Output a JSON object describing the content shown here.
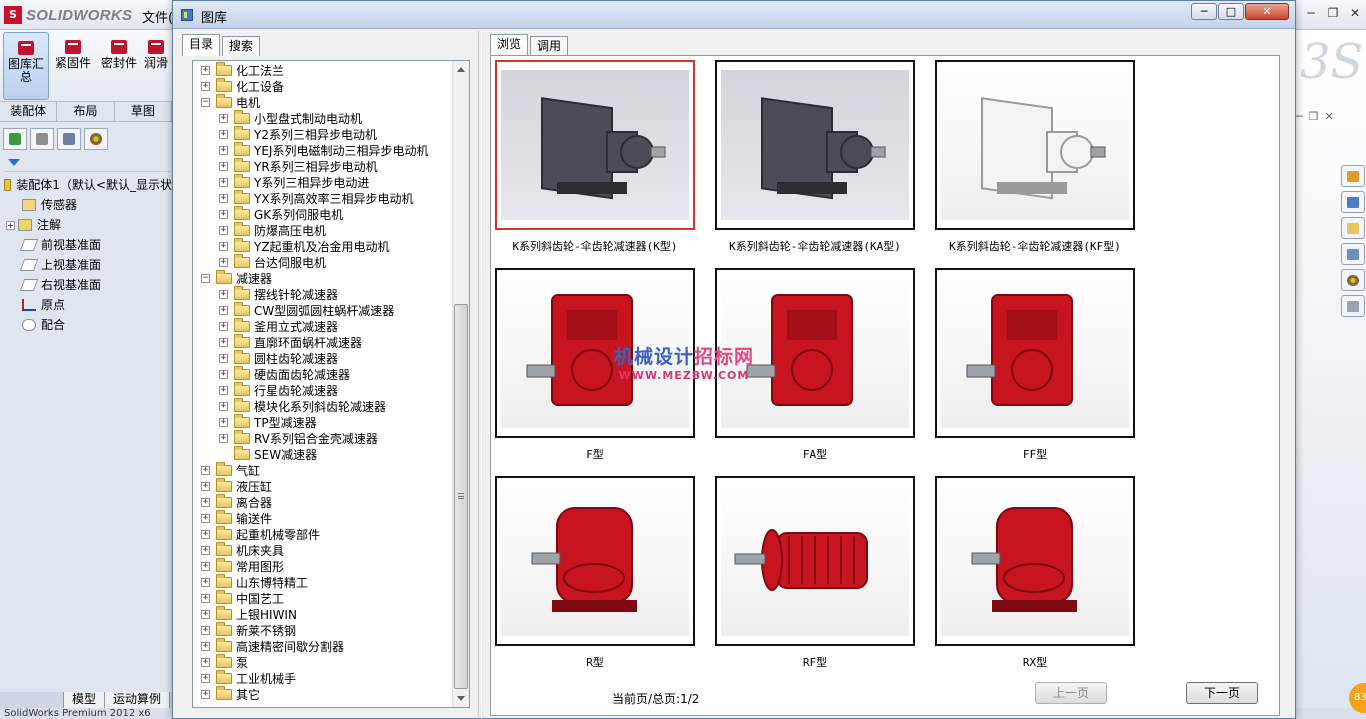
{
  "app": {
    "name": "SOLIDWORKS",
    "menu_first": "文件(",
    "ribbon_buttons": [
      "图库汇总",
      "紧固件",
      "密封件",
      "润滑"
    ],
    "command_tabs": [
      "装配体",
      "布局",
      "草图"
    ],
    "feature_tree": [
      {
        "label": "装配体1（默认<默认_显示状",
        "icon": "assembly-icon"
      },
      {
        "label": "传感器",
        "icon": "sensor-icon"
      },
      {
        "label": "注解",
        "icon": "annotation-icon"
      },
      {
        "label": "前视基准面",
        "icon": "plane-icon"
      },
      {
        "label": "上视基准面",
        "icon": "plane-icon"
      },
      {
        "label": "右视基准面",
        "icon": "plane-icon"
      },
      {
        "label": "原点",
        "icon": "origin-icon"
      },
      {
        "label": "配合",
        "icon": "mate-icon"
      }
    ],
    "bottom_tabs": [
      "模型",
      "运动算例"
    ],
    "status": "SolidWorks Premium 2012 x6",
    "badge": "83"
  },
  "dialog": {
    "title": "图库",
    "left_tabs": [
      "目录",
      "搜索"
    ],
    "tree": [
      {
        "label": "化工法兰",
        "level": 0,
        "expanded": false
      },
      {
        "label": "化工设备",
        "level": 0,
        "expanded": false
      },
      {
        "label": "电机",
        "level": 0,
        "expanded": true
      },
      {
        "label": "小型盘式制动电动机",
        "level": 1,
        "expanded": false
      },
      {
        "label": "Y2系列三相异步电动机",
        "level": 1,
        "expanded": false
      },
      {
        "label": "YEJ系列电磁制动三相异步电动机",
        "level": 1,
        "expanded": false
      },
      {
        "label": "YR系列三相异步电动机",
        "level": 1,
        "expanded": false
      },
      {
        "label": "Y系列三相异步电动进",
        "level": 1,
        "expanded": false
      },
      {
        "label": "YX系列高效率三相异步电动机",
        "level": 1,
        "expanded": false
      },
      {
        "label": "GK系列伺服电机",
        "level": 1,
        "expanded": false
      },
      {
        "label": "防爆高压电机",
        "level": 1,
        "expanded": false
      },
      {
        "label": "YZ起重机及冶金用电动机",
        "level": 1,
        "expanded": false
      },
      {
        "label": "台达伺服电机",
        "level": 1,
        "expanded": false
      },
      {
        "label": "减速器",
        "level": 0,
        "expanded": true
      },
      {
        "label": "摆线针轮减速器",
        "level": 1,
        "expanded": false
      },
      {
        "label": "CW型圆弧圆柱蜗杆减速器",
        "level": 1,
        "expanded": false
      },
      {
        "label": "釜用立式减速器",
        "level": 1,
        "expanded": false
      },
      {
        "label": "直廓环面蜗杆减速器",
        "level": 1,
        "expanded": false
      },
      {
        "label": "圆柱齿轮减速器",
        "level": 1,
        "expanded": false
      },
      {
        "label": "硬齿面齿轮减速器",
        "level": 1,
        "expanded": false
      },
      {
        "label": "行星齿轮减速器",
        "level": 1,
        "expanded": false
      },
      {
        "label": "模块化系列斜齿轮减速器",
        "level": 1,
        "expanded": false
      },
      {
        "label": "TP型减速器",
        "level": 1,
        "expanded": false
      },
      {
        "label": "RV系列铝合金壳减速器",
        "level": 1,
        "expanded": false
      },
      {
        "label": "SEW减速器",
        "level": 1,
        "expanded": null
      },
      {
        "label": "气缸",
        "level": 0,
        "expanded": false
      },
      {
        "label": "液压缸",
        "level": 0,
        "expanded": false
      },
      {
        "label": "离合器",
        "level": 0,
        "expanded": false
      },
      {
        "label": "输送件",
        "level": 0,
        "expanded": false
      },
      {
        "label": "起重机械零部件",
        "level": 0,
        "expanded": false
      },
      {
        "label": "机床夹具",
        "level": 0,
        "expanded": false
      },
      {
        "label": "常用图形",
        "level": 0,
        "expanded": false
      },
      {
        "label": "山东博特精工",
        "level": 0,
        "expanded": false
      },
      {
        "label": "中国艺工",
        "level": 0,
        "expanded": false
      },
      {
        "label": "上银HIWIN",
        "level": 0,
        "expanded": false
      },
      {
        "label": "新莱不锈钢",
        "level": 0,
        "expanded": false
      },
      {
        "label": "高速精密间歇分割器",
        "level": 0,
        "expanded": false
      },
      {
        "label": "泵",
        "level": 0,
        "expanded": false
      },
      {
        "label": "工业机械手",
        "level": 0,
        "expanded": false
      },
      {
        "label": "其它",
        "level": 0,
        "expanded": false
      }
    ],
    "right_tabs": [
      "浏览",
      "调用"
    ],
    "items": [
      {
        "caption": "K系列斜齿轮-伞齿轮减速器(K型)",
        "color": "#4a4d55",
        "bg": "grey",
        "selected": true
      },
      {
        "caption": "K系列斜齿轮-伞齿轮减速器(KA型)",
        "color": "#4a4d55",
        "bg": "grey",
        "selected": false
      },
      {
        "caption": "K系列斜齿轮-伞齿轮减速器(KF型)",
        "color": "#f3f3f3",
        "bg": "white",
        "selected": false
      },
      {
        "caption": "F型",
        "color": "#c8141e",
        "bg": "white",
        "selected": false
      },
      {
        "caption": "FA型",
        "color": "#c8141e",
        "bg": "white",
        "selected": false
      },
      {
        "caption": "FF型",
        "color": "#c8141e",
        "bg": "white",
        "selected": false
      },
      {
        "caption": "R型",
        "color": "#c8141e",
        "bg": "white",
        "selected": false
      },
      {
        "caption": "RF型",
        "color": "#c8141e",
        "bg": "white",
        "selected": false
      },
      {
        "caption": "RX型",
        "color": "#c8141e",
        "bg": "white",
        "selected": false
      }
    ],
    "watermark": {
      "main_prefix": "机械设计",
      "main_suffix": "招标网",
      "url": "WWW.MEZBW.COM"
    },
    "pager": "当前页/总页:1/2",
    "prev_button": "上一页",
    "next_button": "下一页"
  }
}
